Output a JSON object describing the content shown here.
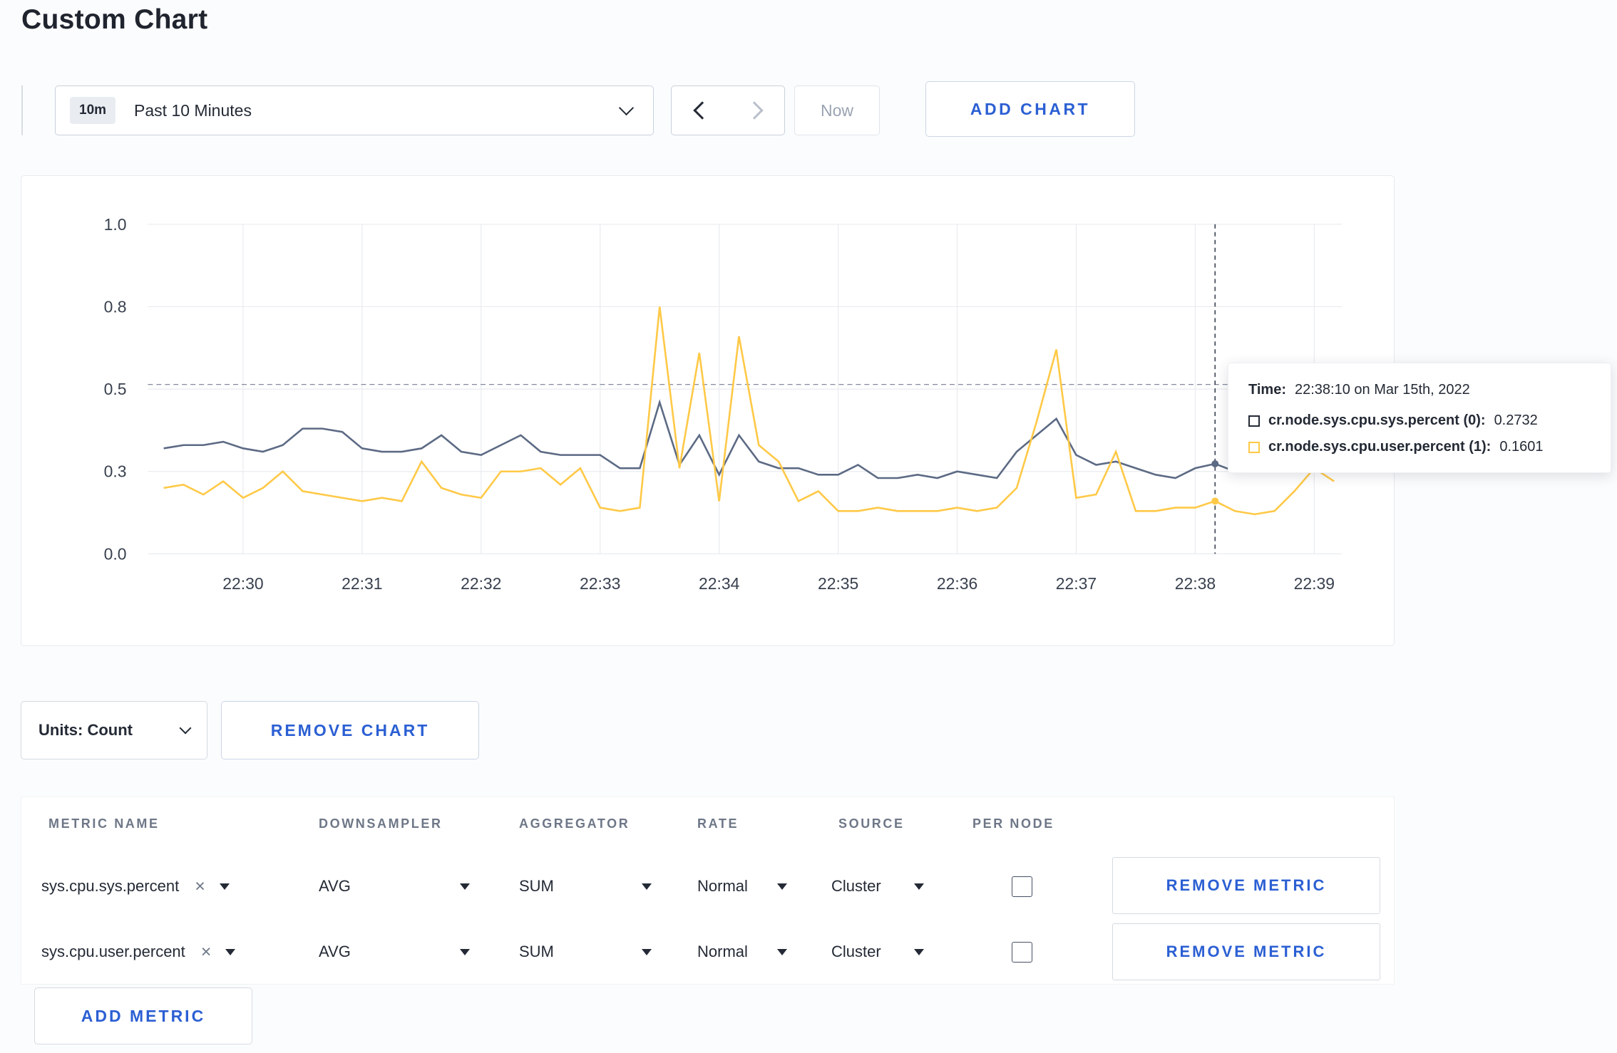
{
  "page": {
    "title": "Custom Chart"
  },
  "colors": {
    "accent": "#2b5fd3",
    "series_sys": "#5c6a84",
    "series_user": "#ffc947"
  },
  "icons": {
    "close": "×"
  },
  "toolbar": {
    "badge": "10m",
    "time_range": "Past 10 Minutes",
    "now": "Now",
    "add_chart": "ADD CHART"
  },
  "units": {
    "label": "Units: Count",
    "remove_chart": "REMOVE CHART"
  },
  "tooltip": {
    "time_label": "Time:",
    "time_value": "22:38:10 on Mar 15th, 2022",
    "rows": [
      {
        "name": "cr.node.sys.cpu.sys.percent (0):",
        "value": "0.2732",
        "color": "#242a35"
      },
      {
        "name": "cr.node.sys.cpu.user.percent (1):",
        "value": "0.1601",
        "color": "#ffc947"
      }
    ]
  },
  "table": {
    "headers": [
      "METRIC NAME",
      "DOWNSAMPLER",
      "AGGREGATOR",
      "RATE",
      "SOURCE",
      "PER NODE"
    ],
    "rows": [
      {
        "metric": "sys.cpu.sys.percent",
        "downsampler": "AVG",
        "aggregator": "SUM",
        "rate": "Normal",
        "source": "Cluster",
        "per_node_checked": false,
        "remove_label": "REMOVE METRIC"
      },
      {
        "metric": "sys.cpu.user.percent",
        "downsampler": "AVG",
        "aggregator": "SUM",
        "rate": "Normal",
        "source": "Cluster",
        "per_node_checked": false,
        "remove_label": "REMOVE METRIC"
      }
    ],
    "add_metric": "ADD METRIC"
  },
  "chart_data": {
    "type": "line",
    "title": "",
    "xlabel": "",
    "ylabel": "",
    "ylim": [
      0,
      1
    ],
    "grid": true,
    "t0": 8,
    "interval_seconds": 10,
    "t_max": 602,
    "y_ticks": [
      {
        "value": 0.0,
        "label": "0.0"
      },
      {
        "value": 0.25,
        "label": "0.3"
      },
      {
        "value": 0.5,
        "label": "0.5"
      },
      {
        "value": 0.75,
        "label": "0.8"
      },
      {
        "value": 1.0,
        "label": "1.0"
      }
    ],
    "x_ticks": [
      {
        "t": 48,
        "label": "22:30"
      },
      {
        "t": 108,
        "label": "22:31"
      },
      {
        "t": 168,
        "label": "22:32"
      },
      {
        "t": 228,
        "label": "22:33"
      },
      {
        "t": 288,
        "label": "22:34"
      },
      {
        "t": 348,
        "label": "22:35"
      },
      {
        "t": 408,
        "label": "22:36"
      },
      {
        "t": 468,
        "label": "22:37"
      },
      {
        "t": 528,
        "label": "22:38"
      },
      {
        "t": 588,
        "label": "22:39"
      }
    ],
    "crosshair": {
      "t": 538,
      "index": 53,
      "time": "22:38:10",
      "hline_value": 0.514
    },
    "series": [
      {
        "name": "cr.node.sys.cpu.sys.percent",
        "color": "#5c6a84",
        "values": [
          0.32,
          0.33,
          0.33,
          0.34,
          0.32,
          0.31,
          0.33,
          0.38,
          0.38,
          0.37,
          0.32,
          0.31,
          0.31,
          0.32,
          0.36,
          0.31,
          0.3,
          0.33,
          0.36,
          0.31,
          0.3,
          0.3,
          0.3,
          0.26,
          0.26,
          0.46,
          0.27,
          0.36,
          0.24,
          0.36,
          0.28,
          0.26,
          0.26,
          0.24,
          0.24,
          0.27,
          0.23,
          0.23,
          0.24,
          0.23,
          0.25,
          0.24,
          0.23,
          0.31,
          0.36,
          0.41,
          0.3,
          0.27,
          0.28,
          0.26,
          0.24,
          0.23,
          0.26,
          0.2732,
          0.25,
          0.25,
          0.27,
          0.25,
          0.26,
          0.28
        ]
      },
      {
        "name": "cr.node.sys.cpu.user.percent",
        "color": "#ffc947",
        "values": [
          0.2,
          0.21,
          0.18,
          0.22,
          0.17,
          0.2,
          0.25,
          0.19,
          0.18,
          0.17,
          0.16,
          0.17,
          0.16,
          0.28,
          0.2,
          0.18,
          0.17,
          0.25,
          0.25,
          0.26,
          0.21,
          0.26,
          0.14,
          0.13,
          0.14,
          0.75,
          0.26,
          0.61,
          0.16,
          0.66,
          0.33,
          0.28,
          0.16,
          0.19,
          0.13,
          0.13,
          0.14,
          0.13,
          0.13,
          0.13,
          0.14,
          0.13,
          0.14,
          0.2,
          0.4,
          0.62,
          0.17,
          0.18,
          0.31,
          0.13,
          0.13,
          0.14,
          0.14,
          0.1601,
          0.13,
          0.12,
          0.13,
          0.19,
          0.26,
          0.22
        ]
      }
    ]
  }
}
